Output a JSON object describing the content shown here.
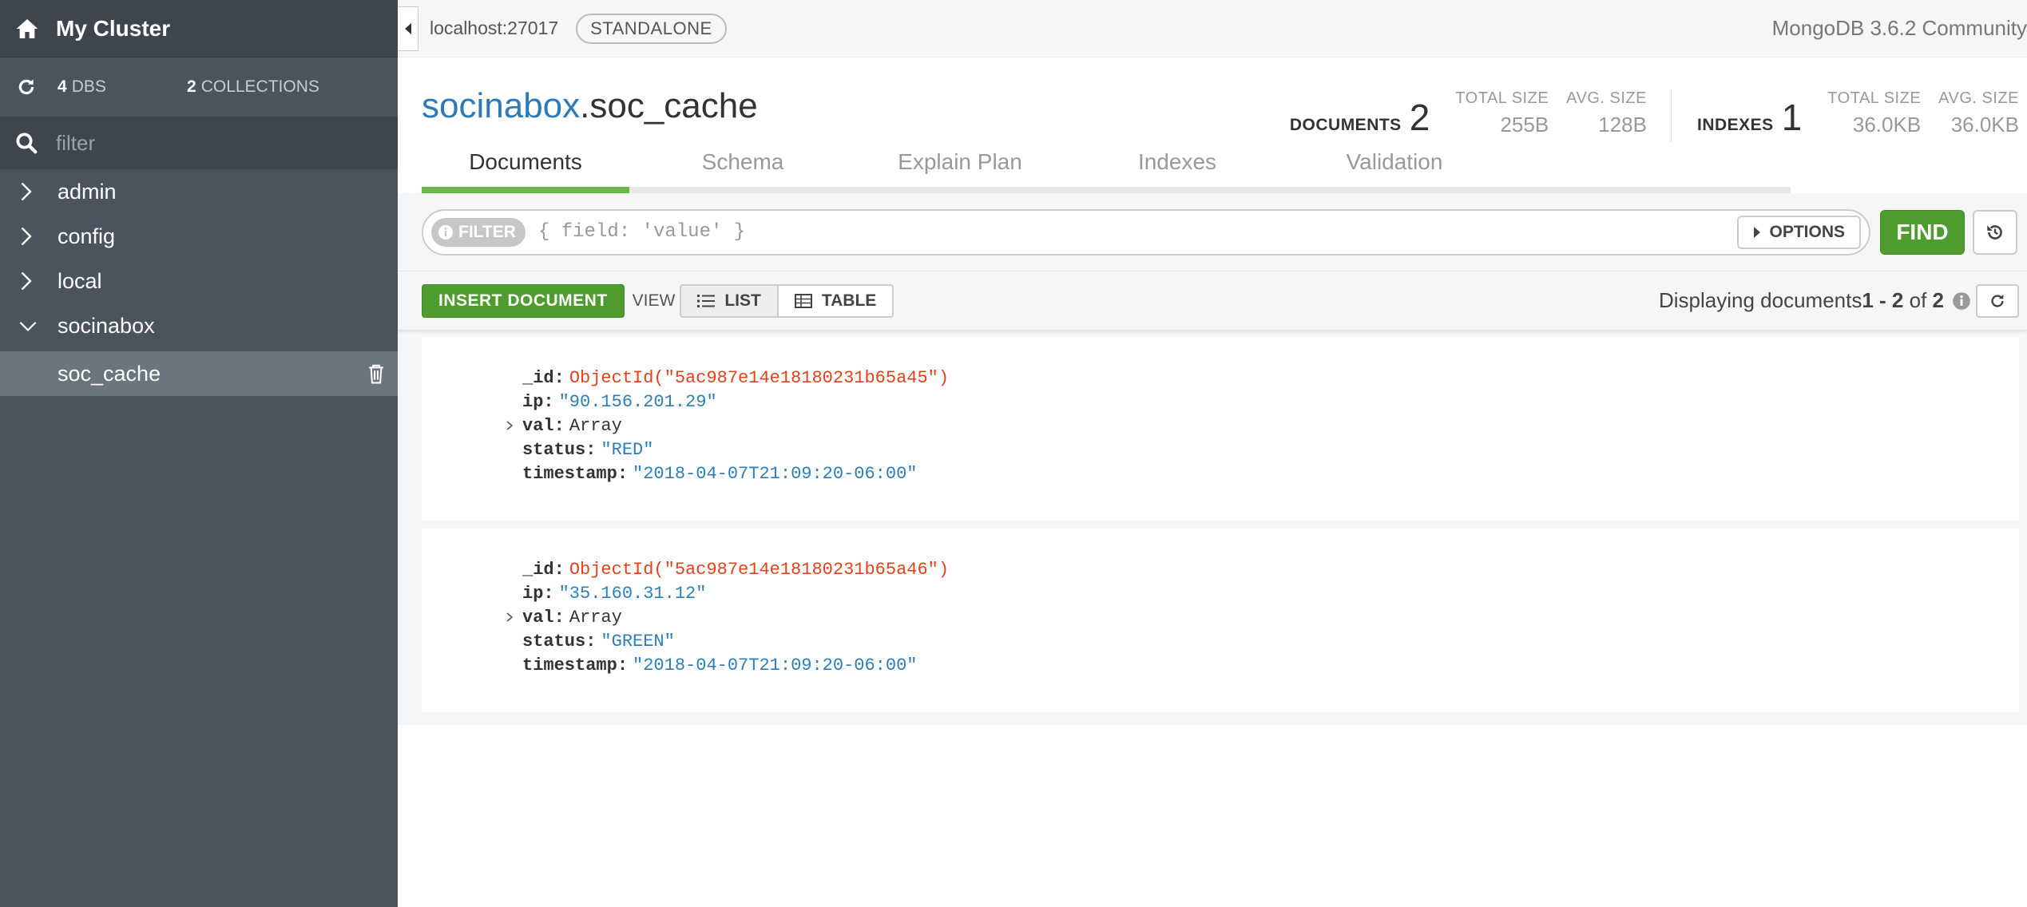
{
  "sidebar": {
    "cluster_name": "My Cluster",
    "dbs_count": "4",
    "dbs_label": "DBS",
    "collections_count": "2",
    "collections_label": "COLLECTIONS",
    "filter_placeholder": "filter",
    "databases": [
      "admin",
      "config",
      "local",
      "socinabox"
    ],
    "selected_collection": "soc_cache"
  },
  "topbar": {
    "host": "localhost:27017",
    "topology": "STANDALONE",
    "version": "MongoDB 3.6.2 Community"
  },
  "collection": {
    "db": "socinabox",
    "name": ".soc_cache",
    "documents_label": "DOCUMENTS",
    "documents_count": "2",
    "doc_total_size_label": "TOTAL SIZE",
    "doc_total_size": "255B",
    "doc_avg_size_label": "AVG. SIZE",
    "doc_avg_size": "128B",
    "indexes_label": "INDEXES",
    "indexes_count": "1",
    "idx_total_size_label": "TOTAL SIZE",
    "idx_total_size": "36.0KB",
    "idx_avg_size_label": "AVG. SIZE",
    "idx_avg_size": "36.0KB"
  },
  "tabs": [
    "Documents",
    "Schema",
    "Explain Plan",
    "Indexes",
    "Validation"
  ],
  "query": {
    "filter_label": "FILTER",
    "filter_placeholder": "{ field: 'value' }",
    "options_label": "OPTIONS",
    "find_label": "FIND"
  },
  "actions": {
    "insert_label": "INSERT DOCUMENT",
    "view_label": "VIEW",
    "list_label": "LIST",
    "table_label": "TABLE",
    "displaying_prefix": "Displaying documents ",
    "range": "1 - 2",
    "of_text": " of ",
    "total": "2"
  },
  "documents": [
    {
      "id_key": "_id:",
      "id_val": "ObjectId(\"5ac987e14e18180231b65a45\")",
      "ip_key": "ip:",
      "ip_val": "\"90.156.201.29\"",
      "val_key": "val:",
      "val_val": "Array",
      "status_key": "status:",
      "status_val": "\"RED\"",
      "ts_key": "timestamp:",
      "ts_val": "\"2018-04-07T21:09:20-06:00\""
    },
    {
      "id_key": "_id:",
      "id_val": "ObjectId(\"5ac987e14e18180231b65a46\")",
      "ip_key": "ip:",
      "ip_val": "\"35.160.31.12\"",
      "val_key": "val:",
      "val_val": "Array",
      "status_key": "status:",
      "status_val": "\"GREEN\"",
      "ts_key": "timestamp:",
      "ts_val": "\"2018-04-07T21:09:20-06:00\""
    }
  ],
  "colors": {
    "sidebar_bg": "#4b535c",
    "accent_green": "#4e9b2e",
    "db_link_blue": "#2e7ab8",
    "objectid_orange": "#e0421c",
    "string_blue": "#2c7fb8"
  }
}
